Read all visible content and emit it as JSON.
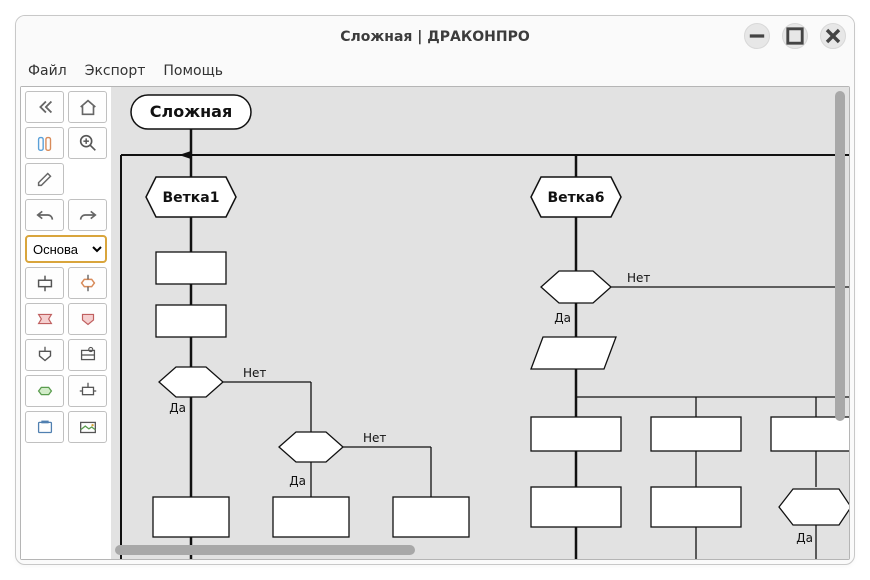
{
  "window": {
    "title": "Сложная | ДРАКОНПРО"
  },
  "menu": {
    "file": "Файл",
    "export": "Экспорт",
    "help": "Помощь"
  },
  "toolbar": {
    "select_value": "Основа"
  },
  "diagram": {
    "header": "Сложная",
    "branch1": "Ветка1",
    "branch6": "Ветка6",
    "yes": "Да",
    "no": "Нет"
  }
}
